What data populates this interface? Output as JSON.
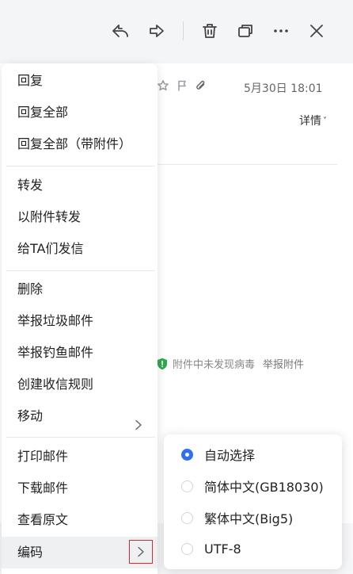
{
  "toolbar": {
    "buttons": [
      "reply-icon",
      "forward-icon",
      "trash-icon",
      "window-icon",
      "more-icon",
      "close-icon"
    ]
  },
  "mail": {
    "date": "5月30日 18:01",
    "detail_label": "详情",
    "detail_chevron": "˅",
    "virus_status": "附件中未发现病毒",
    "report_attachment": "举报附件"
  },
  "menu": {
    "groups": [
      [
        "回复",
        "回复全部",
        "回复全部（带附件）"
      ],
      [
        "转发",
        "以附件转发",
        "给TA们发信"
      ],
      [
        "删除",
        "举报垃圾邮件",
        "举报钓鱼邮件",
        "创建收信规则",
        "移动"
      ],
      [
        "打印邮件",
        "下载邮件",
        "查看原文",
        "编码"
      ]
    ]
  },
  "encoding_submenu": {
    "options": [
      "自动选择",
      "简体中文(GB18030)",
      "繁体中文(Big5)",
      "UTF-8"
    ],
    "selected": "自动选择"
  },
  "colors": {
    "accent": "#2f6ff0",
    "highlight_border": "#e0272e",
    "virus_shield": "#2fa84f"
  }
}
